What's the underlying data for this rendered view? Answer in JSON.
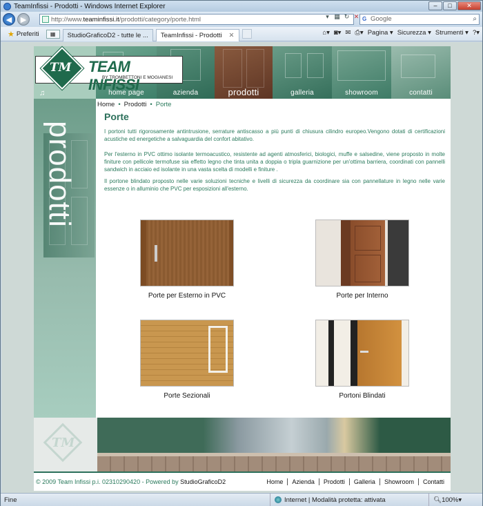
{
  "window": {
    "title": "TeamInfissi - Prodotti - Windows Internet Explorer"
  },
  "address": {
    "url_prefix": "http://www.",
    "url_domain": "teaminfissi.it",
    "url_path": "/prodotti/category/porte.html",
    "search_placeholder": "Google"
  },
  "tabs": {
    "favorites": "Preferiti",
    "items": [
      {
        "label": "StudioGraficoD2 - tutte le ..."
      },
      {
        "label": "TeamInfissi - Prodotti"
      }
    ]
  },
  "commandbar": {
    "page": "Pagina",
    "safety": "Sicurezza",
    "tools": "Strumenti"
  },
  "site": {
    "logo": {
      "initials": "TM",
      "name": "TEAM INFISSI",
      "tagline": "BY TROMBETTONI E MOGIANESI"
    },
    "nav": [
      "home page",
      "azienda",
      "prodotti",
      "galleria",
      "showroom",
      "contatti"
    ],
    "side_label": "prodotti",
    "breadcrumb": {
      "home": "Home",
      "section": "Prodotti",
      "current": "Porte"
    },
    "title": "Porte",
    "paragraphs": [
      "I portoni tutti rigorosamente antintrusione, serrature antiscasso a più punti di chiusura cilindro europeo.Vengono dotati di certificazioni acustiche ed energetiche a salvaguardia del confort abitativo.",
      "Per l'esterno in PVC ottimo isolante termoacustico, resistente ad agenti atmosferici, biologici, muffe e salsedine, viene proposto in molte finiture con pellicole termofuse sia effetto legno che tinta unita a doppia o tripla guarnizione per un'ottima barriera, coordinati con pannelli sandwich in acciaio ed isolante in una vasta scelta di modelli e finiture .",
      "Il portone blindato proposto nelle varie soluzioni tecniche e livelli di sicurezza da coordinare sia con pannellature in legno nelle varie essenze o in alluminio che PVC per esposizioni all'esterno."
    ],
    "products": [
      {
        "caption": "Porte per Esterno in PVC"
      },
      {
        "caption": "Porte per Interno"
      },
      {
        "caption": "Porte Sezionali"
      },
      {
        "caption": "Portoni Blindati"
      }
    ],
    "footer": {
      "copyright": "© 2009 Team Infissi p.i. 02310290420 - Powered by ",
      "powered": "StudioGraficoD2",
      "links": [
        "Home",
        "Azienda",
        "Prodotti",
        "Galleria",
        "Showroom",
        "Contatti"
      ]
    }
  },
  "status": {
    "left": "Fine",
    "zone": "Internet | Modalità protetta: attivata",
    "zoom": "100%"
  }
}
